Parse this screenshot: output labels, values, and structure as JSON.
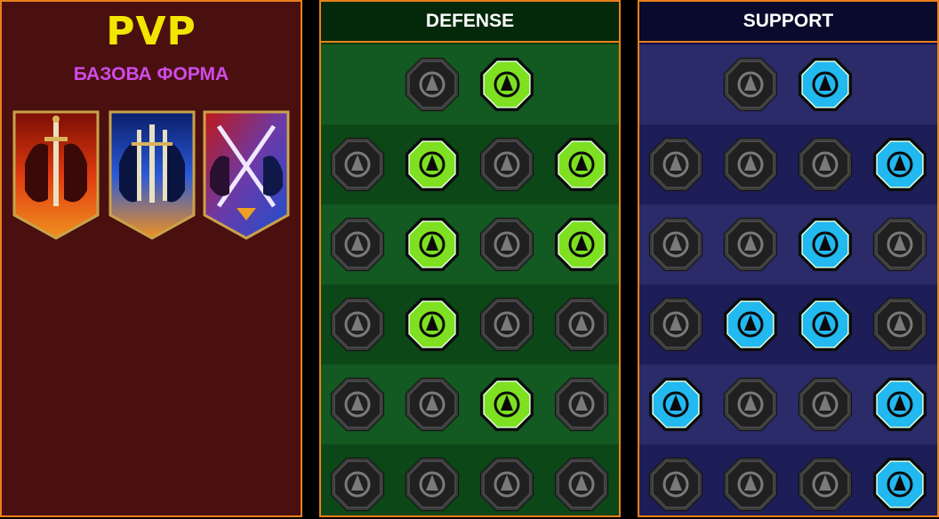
{
  "left_panel": {
    "title": "PVP",
    "subtitle": "БАЗОВА ФОРМА",
    "banners": [
      {
        "name": "red-knights-banner-icon",
        "color": "#d8351a"
      },
      {
        "name": "blue-knights-banner-icon",
        "color": "#2f62c8"
      },
      {
        "name": "crossed-swords-banner-icon",
        "color": "#c8502a"
      }
    ]
  },
  "defense": {
    "title": "DEFENSE",
    "accent": "#7ee020",
    "rows": [
      [
        {
          "name": "brick-wall-icon",
          "active": false
        },
        {
          "name": "raised-fist-icon",
          "active": true
        }
      ],
      [
        {
          "name": "chevron-shield-icon",
          "active": false
        },
        {
          "name": "heart-hand-icon",
          "active": true
        },
        {
          "name": "stone-golem-icon",
          "active": false
        },
        {
          "name": "dual-blades-icon",
          "active": true
        }
      ],
      [
        {
          "name": "flexing-warrior-icon",
          "active": false
        },
        {
          "name": "knight-shield-icon",
          "active": true
        },
        {
          "name": "heart-skull-icon",
          "active": false
        },
        {
          "name": "hooded-figure-icon",
          "active": true
        }
      ],
      [
        {
          "name": "crowd-icon",
          "active": false
        },
        {
          "name": "hourglass-icon",
          "active": true
        },
        {
          "name": "open-palm-icon",
          "active": false
        },
        {
          "name": "bull-head-icon",
          "active": false
        }
      ],
      [
        {
          "name": "dash-figure-icon",
          "active": false
        },
        {
          "name": "claw-marks-icon",
          "active": false
        },
        {
          "name": "glowing-skull-icon",
          "active": true
        },
        {
          "name": "grasping-hand-icon",
          "active": false
        }
      ],
      [
        {
          "name": "spiked-warrior-icon",
          "active": false
        },
        {
          "name": "winged-shield-icon",
          "active": false
        },
        {
          "name": "bearded-face-icon",
          "active": false
        },
        {
          "name": "strongman-icon",
          "active": false
        }
      ]
    ]
  },
  "support": {
    "title": "SUPPORT",
    "accent": "#22b8f0",
    "rows": [
      [
        {
          "name": "heart-plus-icon",
          "active": false
        },
        {
          "name": "target-hand-icon",
          "active": true
        }
      ],
      [
        {
          "name": "praying-hands-icon",
          "active": false
        },
        {
          "name": "shield-arcs-icon",
          "active": false
        },
        {
          "name": "smoking-skull-icon",
          "active": false
        },
        {
          "name": "flowing-hand-icon",
          "active": true
        }
      ],
      [
        {
          "name": "sparkle-figure-icon",
          "active": false
        },
        {
          "name": "lightning-icon",
          "active": false
        },
        {
          "name": "cracked-lightning-icon",
          "active": true
        },
        {
          "name": "twin-figures-icon",
          "active": false
        }
      ],
      [
        {
          "name": "chained-heart-icon",
          "active": false
        },
        {
          "name": "comet-icon",
          "active": true
        },
        {
          "name": "open-book-icon",
          "active": true
        },
        {
          "name": "angry-face-icon",
          "active": false
        }
      ],
      [
        {
          "name": "compass-star-icon",
          "active": true
        },
        {
          "name": "boot-icon",
          "active": false
        },
        {
          "name": "all-seeing-eye-icon",
          "active": false
        },
        {
          "name": "voodoo-doll-icon",
          "active": true
        }
      ],
      [
        {
          "name": "potion-flask-icon",
          "active": false
        },
        {
          "name": "horned-skull-icon",
          "active": false
        },
        {
          "name": "fist-glyph-icon",
          "active": false
        },
        {
          "name": "eagle-head-icon",
          "active": true
        }
      ]
    ]
  }
}
